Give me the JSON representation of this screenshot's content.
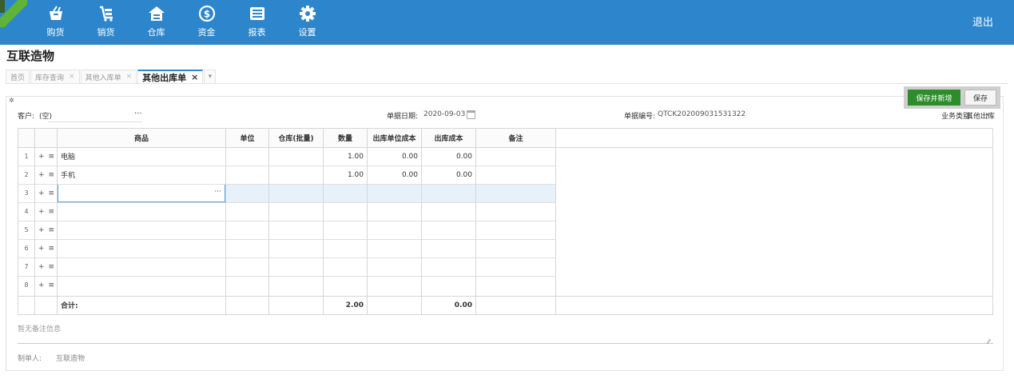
{
  "nav": {
    "items": [
      {
        "label": "购货",
        "icon": "basket-icon"
      },
      {
        "label": "销货",
        "icon": "cart-icon"
      },
      {
        "label": "仓库",
        "icon": "warehouse-icon"
      },
      {
        "label": "资金",
        "icon": "dollar-icon"
      },
      {
        "label": "报表",
        "icon": "report-icon"
      },
      {
        "label": "设置",
        "icon": "gear-icon"
      }
    ],
    "logout": "退出"
  },
  "page": {
    "title": "互联造物"
  },
  "tabs": [
    {
      "label": "首页",
      "closable": false
    },
    {
      "label": "库存查询",
      "closable": true
    },
    {
      "label": "其他入库单",
      "closable": true
    },
    {
      "label": "其他出库单",
      "closable": true,
      "active": true
    }
  ],
  "tab_close": "×",
  "tab_more": "▾",
  "form": {
    "customer_label": "客户:",
    "customer_value": "(空)",
    "customer_picker": "···",
    "date_label": "单据日期:",
    "date_value": "2020-09-03",
    "number_label": "单据编号:",
    "number_value": "QTCK202009031531322",
    "biz_label": "业务类别:",
    "biz_value": "其他出库",
    "save_new": "保存并新增",
    "save": "保存"
  },
  "grid": {
    "headers": [
      "商品",
      "单位",
      "仓库(批量)",
      "数量",
      "出库单位成本",
      "出库成本",
      "备注"
    ],
    "rows": [
      {
        "num": "1",
        "product": "电脑",
        "unit": "",
        "warehouse": "",
        "qty": "1.00",
        "unit_cost": "0.00",
        "cost": "0.00",
        "remark": ""
      },
      {
        "num": "2",
        "product": "手机",
        "unit": "",
        "warehouse": "",
        "qty": "1.00",
        "unit_cost": "0.00",
        "cost": "0.00",
        "remark": ""
      },
      {
        "num": "3",
        "product": "",
        "unit": "",
        "warehouse": "",
        "qty": "",
        "unit_cost": "",
        "cost": "",
        "remark": ""
      },
      {
        "num": "4",
        "product": "",
        "unit": "",
        "warehouse": "",
        "qty": "",
        "unit_cost": "",
        "cost": "",
        "remark": ""
      },
      {
        "num": "5",
        "product": "",
        "unit": "",
        "warehouse": "",
        "qty": "",
        "unit_cost": "",
        "cost": "",
        "remark": ""
      },
      {
        "num": "6",
        "product": "",
        "unit": "",
        "warehouse": "",
        "qty": "",
        "unit_cost": "",
        "cost": "",
        "remark": ""
      },
      {
        "num": "7",
        "product": "",
        "unit": "",
        "warehouse": "",
        "qty": "",
        "unit_cost": "",
        "cost": "",
        "remark": ""
      },
      {
        "num": "8",
        "product": "",
        "unit": "",
        "warehouse": "",
        "qty": "",
        "unit_cost": "",
        "cost": "",
        "remark": ""
      }
    ],
    "add_glyph": "+",
    "delete_glyph": "≡",
    "editor_picker": "···",
    "total_label": "合计:",
    "total_qty": "2.00",
    "total_cost": "0.00"
  },
  "footer": {
    "note_placeholder": "暂无备注信息",
    "resize_glyph": "⁄⁄",
    "maker_label": "制单人:",
    "maker_value": "互联造物"
  },
  "colors": {
    "topbar": "#2d86cc",
    "save_new_button": "#2d8d2b",
    "active_row": "#e6f1f9"
  }
}
